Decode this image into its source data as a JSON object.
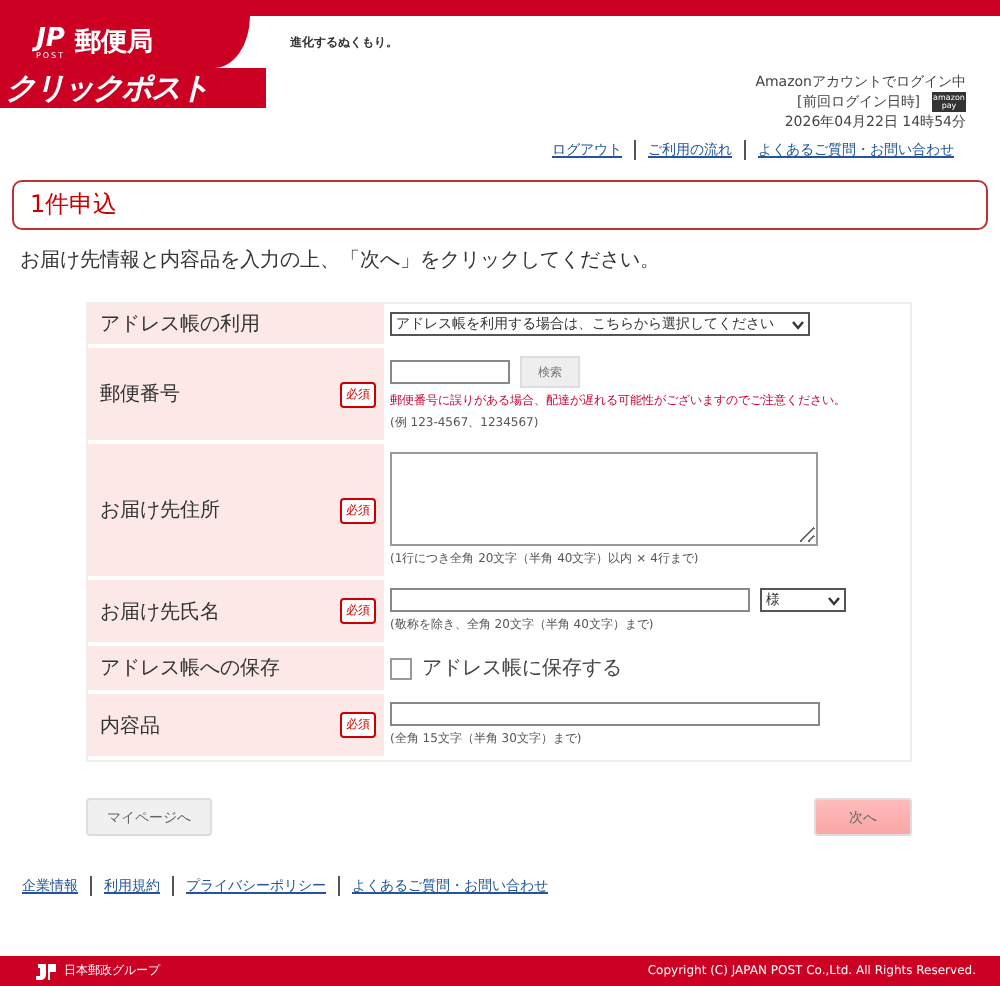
{
  "header": {
    "logo_mark": "JP",
    "logo_sub": "POST",
    "logo_name": "郵便局",
    "service_name": "クリックポスト",
    "tagline": "進化するぬくもり。"
  },
  "account": {
    "status": "Amazonアカウントでログイン中",
    "last_login_label": "[前回ログイン日時]",
    "last_login": "2026年04月22日 14時54分",
    "badge_top": "amazon",
    "badge_bottom": "pay"
  },
  "header_links": [
    "ログアウト",
    "ご利用の流れ",
    "よくあるご質問・お問い合わせ"
  ],
  "page_title": "1件申込",
  "instruction": "お届け先情報と内容品を入力の上、「次へ」をクリックしてください。",
  "form_rows": [
    {
      "kind": "select",
      "label": "アドレス帳の利用",
      "value": "アドレス帳を利用する場合は、こちらから選択してください"
    },
    {
      "kind": "postal",
      "label": "郵便番号",
      "badge": "必須",
      "button": "検索",
      "warning": "郵便番号に誤りがある場合、配達が遅れる可能性がございますのでご注意ください。",
      "hint": "(例 123-4567、1234567)"
    },
    {
      "kind": "textarea",
      "label": "お届け先住所",
      "badge": "必須",
      "hint": "(1行につき全角 20文字（半角 40文字）以内 × 4行まで)"
    },
    {
      "kind": "name",
      "label": "お届け先氏名",
      "badge": "必須",
      "honorific": "様",
      "hint": "(敬称を除き、全角 20文字（半角 40文字）まで)"
    },
    {
      "kind": "checkbox",
      "label": "アドレス帳への保存",
      "option": "アドレス帳に保存する",
      "checked": false
    },
    {
      "kind": "text",
      "label": "内容品",
      "badge": "必須",
      "hint": "(全角 15文字（半角 30文字）まで)"
    }
  ],
  "buttons": {
    "back": "マイページへ",
    "next": "次へ"
  },
  "footer_links": [
    "企業情報",
    "利用規約",
    "プライバシーポリシー",
    "よくあるご質問・お問い合わせ"
  ],
  "footer": {
    "group_name": "日本郵政グループ",
    "copyright": "Copyright (C) JAPAN POST Co.,Ltd.  All Rights Reserved."
  }
}
